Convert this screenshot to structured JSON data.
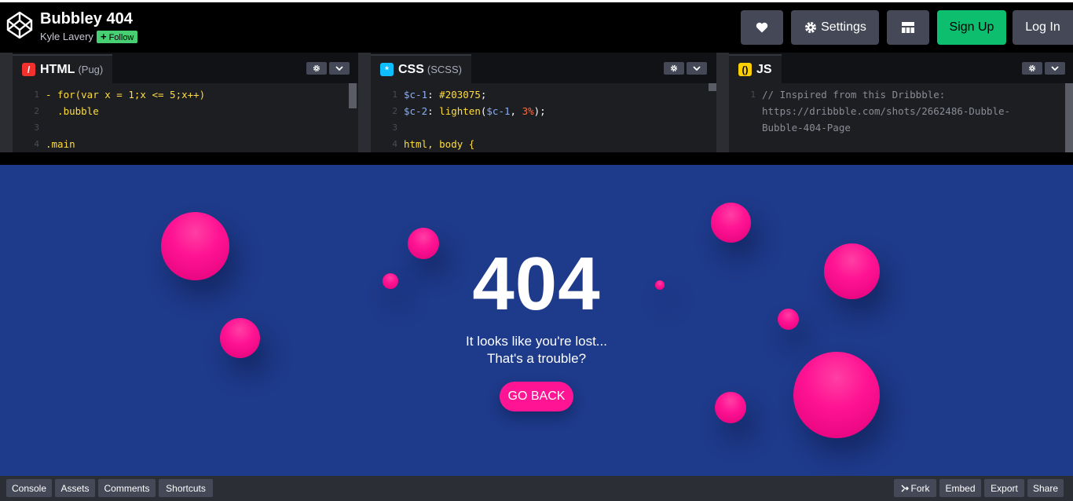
{
  "pen": {
    "title": "Bubbley 404",
    "author": "Kyle Lavery",
    "follow_label": "Follow"
  },
  "header": {
    "settings_label": "Settings",
    "signup_label": "Sign Up",
    "login_label": "Log In"
  },
  "panes": {
    "html": {
      "label": "HTML",
      "sub": "(Pug)",
      "lines": [
        "- for(var x = 1;x <= 5;x++)",
        "  .bubble",
        "",
        ".main"
      ]
    },
    "css": {
      "label": "CSS",
      "sub": "(SCSS)",
      "lines": [
        "$c-1: #203075;",
        "$c-2: lighten($c-1, 3%);",
        "",
        "html, body {"
      ]
    },
    "js": {
      "label": "JS",
      "lines": [
        "// Inspired from this Dribbble:",
        "https://dribbble.com/shots/2662486-Dubble-",
        "Bubble-404-Page"
      ]
    }
  },
  "preview": {
    "code": "404",
    "line1": "It looks like you're lost...",
    "line2": "That's a trouble?",
    "button": "GO BACK"
  },
  "footer": {
    "console": "Console",
    "assets": "Assets",
    "comments": "Comments",
    "shortcuts": "Shortcuts",
    "fork": "Fork",
    "embed": "Embed",
    "export": "Export",
    "share": "Share"
  },
  "colors": {
    "preview_bg": "#1e3a8a",
    "bubble": "#ff1493",
    "accent_green": "#0ebe6f"
  }
}
